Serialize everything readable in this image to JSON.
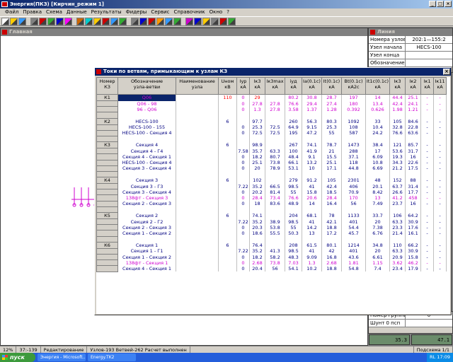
{
  "app": {
    "title": "Энергия(ПКЗ)  [Кирчин_режим 1]"
  },
  "menu": [
    "Файл",
    "Правка",
    "Схема",
    "Данные",
    "Результаты",
    "Фидеры",
    "Сервис",
    "Справочник",
    "Окно",
    "?"
  ],
  "main_window": {
    "title": "Главная"
  },
  "props_window": {
    "title": "Линия",
    "rows": [
      {
        "k": "Номера узлов",
        "v": "202:1—155:2"
      },
      {
        "k": "Узел начала",
        "v": "HECS-100"
      },
      {
        "k": "Узел конца",
        "v": ""
      },
      {
        "k": "Обозначение",
        "v": ""
      }
    ]
  },
  "props_window2": {
    "rows": [
      {
        "k": "Номер группы",
        "v": "0"
      },
      {
        "k": "Шунт 0 псп",
        "v": ""
      }
    ]
  },
  "table_window": {
    "title": "Токи по ветвям, примыкающим к узлам КЗ",
    "headers": [
      "Номер КЗ",
      "Обозначение узла-ветви",
      "Наименование узла",
      "Uном кВ",
      "Iур кА",
      "Iк3 кА",
      "Iк3max кА",
      "iуд кА",
      "Ia(0.1c) кА",
      "It(0.1c) кА",
      "Bt(0.1c) кА2c",
      "It1c(0.1c) кА",
      "Iк3 кА",
      "Iк2 кА",
      "Iк1 кА",
      "Iк11 кА"
    ],
    "rows": [
      {
        "k": "К1",
        "name": "Q06",
        "u": "110",
        "c": [
          "0",
          "29",
          "",
          "80.2",
          "30.8",
          "28.7",
          "197",
          "14",
          "44.4",
          "25.1",
          "-",
          "-"
        ],
        "style": "mag",
        "sel": true
      },
      {
        "k": "",
        "name": "Q06 - 98",
        "u": "",
        "c": [
          "0",
          "27.8",
          "27.8",
          "76.6",
          "29.4",
          "27.4",
          "180",
          "13.4",
          "42.4",
          "24.1",
          "-",
          "-"
        ],
        "style": "mag"
      },
      {
        "k": "",
        "name": "96 - Q06",
        "u": "",
        "c": [
          "0",
          "1.3",
          "27.8",
          "3.58",
          "1.37",
          "1.28",
          "0.392",
          "0.626",
          "1.98",
          "1.21",
          "-",
          "-"
        ],
        "style": "mag"
      },
      {
        "k": "",
        "name": "",
        "u": "",
        "c": [
          "",
          "",
          "",
          "",
          "",
          "",
          "",
          "",
          "",
          "",
          "",
          ""
        ],
        "style": "blue"
      },
      {
        "k": "К2",
        "name": "HECS-100",
        "u": "6",
        "c": [
          "",
          "97.7",
          "",
          "260",
          "56.3",
          "80.3",
          "1092",
          "33",
          "105",
          "84.6",
          "-",
          "-"
        ],
        "style": "blue"
      },
      {
        "k": "",
        "name": "HECS-100 - 155",
        "u": "",
        "c": [
          "0",
          "25.3",
          "72.5",
          "64.9",
          "9.15",
          "25.3",
          "108",
          "10.4",
          "32.8",
          "22.8",
          "-",
          "-"
        ],
        "style": "blue"
      },
      {
        "k": "",
        "name": "HECS-100 - Секция 4",
        "u": "",
        "c": [
          "0",
          "72.5",
          "72.5",
          "195",
          "47.2",
          "55",
          "587",
          "24.2",
          "76.6",
          "63.6",
          "-",
          "-"
        ],
        "style": "blue"
      },
      {
        "k": "",
        "name": "",
        "u": "",
        "c": [
          "",
          "",
          "",
          "",
          "",
          "",
          "",
          "",
          "",
          "",
          "",
          ""
        ],
        "style": "blue"
      },
      {
        "k": "К3",
        "name": "Секция 4",
        "u": "6",
        "c": [
          "",
          "98.9",
          "",
          "267",
          "74.1",
          "78.7",
          "1473",
          "38.4",
          "121",
          "85.7",
          "-",
          "-"
        ],
        "style": "blue"
      },
      {
        "k": "",
        "name": "Секция 4 - Г4",
        "u": "",
        "c": [
          "7.58",
          "35.7",
          "63.3",
          "100",
          "41.9",
          "21",
          "288",
          "17",
          "53.6",
          "31.7",
          "-",
          "-"
        ],
        "style": "blue"
      },
      {
        "k": "",
        "name": "Секция 4 - Секция 1",
        "u": "",
        "c": [
          "0",
          "18.2",
          "80.7",
          "48.4",
          "9.1",
          "15.5",
          "37.1",
          "6.09",
          "19.3",
          "16",
          "-",
          "-"
        ],
        "style": "blue"
      },
      {
        "k": "",
        "name": "HECS-100 - Секция 4",
        "u": "",
        "c": [
          "0",
          "25.1",
          "73.8",
          "66.1",
          "13.2",
          "25.1",
          "118",
          "10.8",
          "34.3",
          "22.6",
          "-",
          "-"
        ],
        "style": "blue"
      },
      {
        "k": "",
        "name": "Секция 3 - Секция 4",
        "u": "",
        "c": [
          "0",
          "20",
          "78.9",
          "53.1",
          "10",
          "17.1",
          "44.8",
          "6.69",
          "21.2",
          "17.5",
          "-",
          "-"
        ],
        "style": "blue"
      },
      {
        "k": "",
        "name": "",
        "u": "",
        "c": [
          "",
          "",
          "",
          "",
          "",
          "",
          "",
          "",
          "",
          "",
          "",
          ""
        ],
        "style": "blue"
      },
      {
        "k": "К4",
        "name": "Секция 3",
        "u": "6",
        "c": [
          "",
          "102",
          "",
          "279",
          "91.2",
          "105",
          "2301",
          "48",
          "152",
          "88",
          "-",
          "-"
        ],
        "style": "blue"
      },
      {
        "k": "",
        "name": "Секция 3 - Г3",
        "u": "",
        "c": [
          "7.22",
          "35.2",
          "66.5",
          "98.5",
          "41",
          "42.4",
          "406",
          "20.1",
          "63.7",
          "31.4",
          "-",
          "-"
        ],
        "style": "blue"
      },
      {
        "k": "",
        "name": "Секция 3 - Секция 4",
        "u": "",
        "c": [
          "0",
          "20.2",
          "81.4",
          "55",
          "15.8",
          "18.5",
          "70.9",
          "8.42",
          "26.6",
          "17.7",
          "-",
          "-"
        ],
        "style": "blue"
      },
      {
        "k": "",
        "name": "138фт - Секция 3",
        "u": "",
        "c": [
          "0",
          "28.4",
          "73.4",
          "76.6",
          "20.6",
          "28.4",
          "170",
          "13",
          "41.2",
          "458",
          "-",
          "-"
        ],
        "style": "mag"
      },
      {
        "k": "",
        "name": "Секция 2 - Секция 3",
        "u": "",
        "c": [
          "0",
          "18",
          "83.6",
          "48.9",
          "14",
          "16.4",
          "56",
          "7.49",
          "23.7",
          "16",
          "-",
          "-"
        ],
        "style": "blue"
      },
      {
        "k": "",
        "name": "",
        "u": "",
        "c": [
          "",
          "",
          "",
          "",
          "",
          "",
          "",
          "",
          "",
          "",
          "",
          ""
        ],
        "style": "blue"
      },
      {
        "k": "К5",
        "name": "Секция 2",
        "u": "6",
        "c": [
          "",
          "74.1",
          "",
          "204",
          "68.1",
          "78",
          "1133",
          "33.7",
          "106",
          "64.2",
          "-",
          "-"
        ],
        "style": "blue"
      },
      {
        "k": "",
        "name": "Секция 2 - Г2",
        "u": "",
        "c": [
          "7.22",
          "35.2",
          "38.9",
          "98.5",
          "41",
          "42.1",
          "401",
          "20",
          "63.3",
          "30.9",
          "-",
          "-"
        ],
        "style": "blue"
      },
      {
        "k": "",
        "name": "Секция 2 - Секция 3",
        "u": "",
        "c": [
          "0",
          "20.3",
          "53.8",
          "55",
          "14.2",
          "18.8",
          "54.4",
          "7.38",
          "23.3",
          "17.6",
          "-",
          "-"
        ],
        "style": "blue"
      },
      {
        "k": "",
        "name": "Секция 1 - Секция 2",
        "u": "",
        "c": [
          "0",
          "18.6",
          "55.5",
          "50.3",
          "13",
          "17.2",
          "45.7",
          "6.76",
          "21.4",
          "16.1",
          "-",
          "-"
        ],
        "style": "blue"
      },
      {
        "k": "",
        "name": "",
        "u": "",
        "c": [
          "",
          "",
          "",
          "",
          "",
          "",
          "",
          "",
          "",
          "",
          "",
          ""
        ],
        "style": "blue"
      },
      {
        "k": "К6",
        "name": "Секция 1",
        "u": "6",
        "c": [
          "",
          "76.4",
          "",
          "208",
          "61.5",
          "80.1",
          "1214",
          "34.8",
          "110",
          "66.2",
          "-",
          "-"
        ],
        "style": "blue"
      },
      {
        "k": "",
        "name": "Секция 1 - Г1",
        "u": "",
        "c": [
          "7.22",
          "35.2",
          "41.3",
          "98.5",
          "41",
          "42",
          "401",
          "20",
          "63.3",
          "30.9",
          "-",
          "-"
        ],
        "style": "blue"
      },
      {
        "k": "",
        "name": "Секция 1 - Секция 2",
        "u": "",
        "c": [
          "0",
          "18.2",
          "58.2",
          "48.3",
          "9.09",
          "16.8",
          "43.6",
          "6.61",
          "20.9",
          "15.8",
          "-",
          "-"
        ],
        "style": "blue"
      },
      {
        "k": "",
        "name": "138фт - Секция 1",
        "u": "",
        "c": [
          "0",
          "2.68",
          "73.8",
          "7.03",
          "1.3",
          "2.68",
          "1.81",
          "1.15",
          "3.62",
          "46.2",
          "-",
          "-"
        ],
        "style": "mag"
      },
      {
        "k": "",
        "name": "Секция 4 - Секция 1",
        "u": "",
        "c": [
          "0",
          "20.4",
          "56",
          "54.1",
          "10.2",
          "18.8",
          "54.8",
          "7.4",
          "23.4",
          "17.9",
          "-",
          "-"
        ],
        "style": "blue"
      }
    ]
  },
  "status": [
    "12%",
    "37:-139",
    "Редактирование",
    "Узлов-193  Ветвей-262  Расчет выполнен",
    "",
    "Подсхема 1/1"
  ],
  "taskbar": {
    "start": "пуск",
    "tasks": [
      "Энергия - Microsoft...",
      "Energy.TK2"
    ],
    "clock": "17:09",
    "lang": "RL"
  },
  "gauges": [
    "35.3",
    "47.1"
  ],
  "colors": {
    "title_active": "#0a246a",
    "row_blue": "#000080",
    "row_magenta": "#d000d0",
    "kz_red": "#ff0000"
  }
}
